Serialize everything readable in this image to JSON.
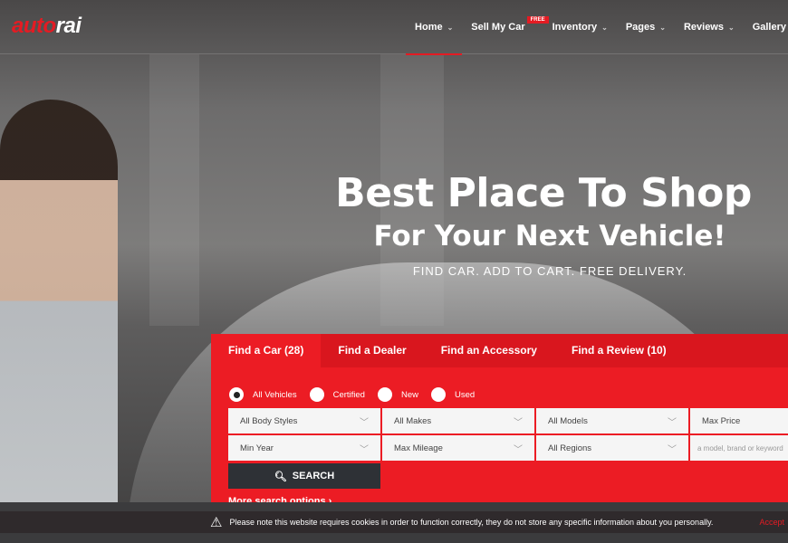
{
  "logo": {
    "part1": "auto",
    "part2": "rai"
  },
  "nav": [
    {
      "label": "Home",
      "active": true,
      "dropdown": true
    },
    {
      "label": "Sell My Car",
      "badge": "FREE",
      "dropdown": false
    },
    {
      "label": "Inventory",
      "dropdown": true
    },
    {
      "label": "Pages",
      "dropdown": true
    },
    {
      "label": "Reviews",
      "dropdown": true
    },
    {
      "label": "Gallery",
      "dropdown": false
    }
  ],
  "hero": {
    "title": "Best Place To Shop",
    "subtitle": "For Your Next Vehicle!",
    "tagline": "FIND CAR. ADD TO CART. FREE DELIVERY."
  },
  "search": {
    "tabs": [
      "Find a Car (28)",
      "Find a Dealer",
      "Find an Accessory",
      "Find a Review (10)"
    ],
    "radios": [
      "All Vehicles",
      "Certified",
      "New",
      "Used"
    ],
    "selected_radio": "All Vehicles",
    "fields": [
      "All Body Styles",
      "All Makes",
      "All Models",
      "Max Price",
      "Min Year",
      "Max Mileage",
      "All Regions"
    ],
    "keyword_placeholder": "a model, brand or keyword",
    "search_label": "SEARCH",
    "more_label": "More search options"
  },
  "cookie": {
    "text": "Please note this website requires cookies in order to function correctly, they do not store any specific information about you personally.",
    "accept": "Accept"
  },
  "colors": {
    "accent": "#ec1c24",
    "dark": "#2e3136"
  }
}
